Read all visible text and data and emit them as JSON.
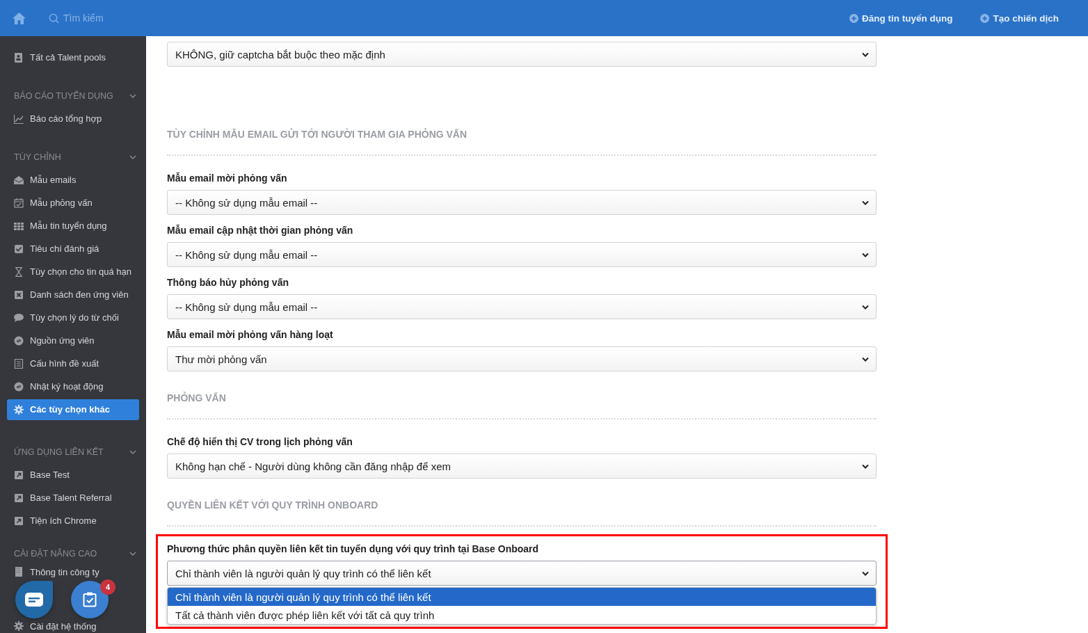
{
  "header": {
    "search_placeholder": "Tìm kiếm",
    "actions": [
      "Đăng tin tuyển dụng",
      "Tạo chiến dịch"
    ]
  },
  "sidebar": {
    "sections": [
      {
        "items": [
          {
            "label": "Tất cả Talent pools",
            "selected": false
          }
        ]
      },
      {
        "title": "BÁO CÁO TUYỂN DỤNG",
        "expanded": true,
        "items": [
          {
            "label": "Báo cáo tổng hợp",
            "selected": false
          }
        ]
      },
      {
        "title": "TÙY CHỈNH",
        "expanded": true,
        "items": [
          {
            "label": "Mẫu emails",
            "selected": false
          },
          {
            "label": "Mẫu phỏng vấn",
            "selected": false
          },
          {
            "label": "Mẫu tin tuyển dụng",
            "selected": false
          },
          {
            "label": "Tiêu chí đánh giá",
            "selected": false
          },
          {
            "label": "Tùy chọn cho tin quá hạn",
            "selected": false
          },
          {
            "label": "Danh sách đen ứng viên",
            "selected": false
          },
          {
            "label": "Tùy chọn lý do từ chối",
            "selected": false
          },
          {
            "label": "Nguồn ứng viên",
            "selected": false
          },
          {
            "label": "Cấu hình đề xuất",
            "selected": false
          },
          {
            "label": "Nhật ký hoạt động",
            "selected": false
          },
          {
            "label": "Các tùy chọn khác",
            "selected": true
          }
        ]
      },
      {
        "title": "ỨNG DỤNG LIÊN KẾT",
        "expanded": true,
        "items": [
          {
            "label": "Base Test",
            "selected": false
          },
          {
            "label": "Base Talent Referral",
            "selected": false
          },
          {
            "label": "Tiện ích Chrome",
            "selected": false
          }
        ]
      },
      {
        "title": "CÀI ĐẶT NÂNG CAO",
        "expanded": true,
        "items": [
          {
            "label": "Thông tin công ty",
            "selected": false
          },
          {
            "label": "Cài đặt hệ thống",
            "selected": false
          }
        ]
      }
    ]
  },
  "floating_buttons": {
    "task_badge": "4"
  },
  "content": [
    {
      "kind": "select",
      "value": "KHÔNG, giữ captcha bắt buộc theo mặc định"
    },
    {
      "kind": "heading",
      "text": "TÙY CHỈNH MẪU EMAIL GỬI TỚI NGƯỜI THAM GIA PHỎNG VẤN"
    },
    {
      "kind": "select",
      "label": "Mẫu email mời phỏng vấn",
      "value": "-- Không sử dụng mẫu email --"
    },
    {
      "kind": "select",
      "label": "Mẫu email cập nhật thời gian phỏng vấn",
      "value": "-- Không sử dụng mẫu email --"
    },
    {
      "kind": "select",
      "label": "Thông báo hủy phỏng vấn",
      "value": "-- Không sử dụng mẫu email --"
    },
    {
      "kind": "select",
      "label": "Mẫu email mời phỏng vấn hàng loạt",
      "value": "Thư mời phỏng vấn"
    },
    {
      "kind": "heading",
      "text": "PHỎNG VẤN"
    },
    {
      "kind": "select",
      "label": "Chế độ hiển thị CV trong lịch phỏng vấn",
      "value": "Không hạn chế - Người dùng không cần đăng nhập để xem"
    },
    {
      "kind": "heading",
      "text": "QUYỀN LIÊN KẾT VỚI QUY TRÌNH ONBOARD"
    },
    {
      "kind": "select",
      "highlighted": true,
      "label": "Phương thức phân quyền liên kết tin tuyển dụng với quy trình tại Base Onboard",
      "value": "Chỉ thành viên là người quản lý quy trình có thể liên kết",
      "expanded": true,
      "options": [
        {
          "label": "Chỉ thành viên là người quản lý quy trình có thể liên kết",
          "selected": true
        },
        {
          "label": "Tất cả thành viên được phép liên kết với tất cả quy trình",
          "selected": false
        }
      ]
    }
  ]
}
